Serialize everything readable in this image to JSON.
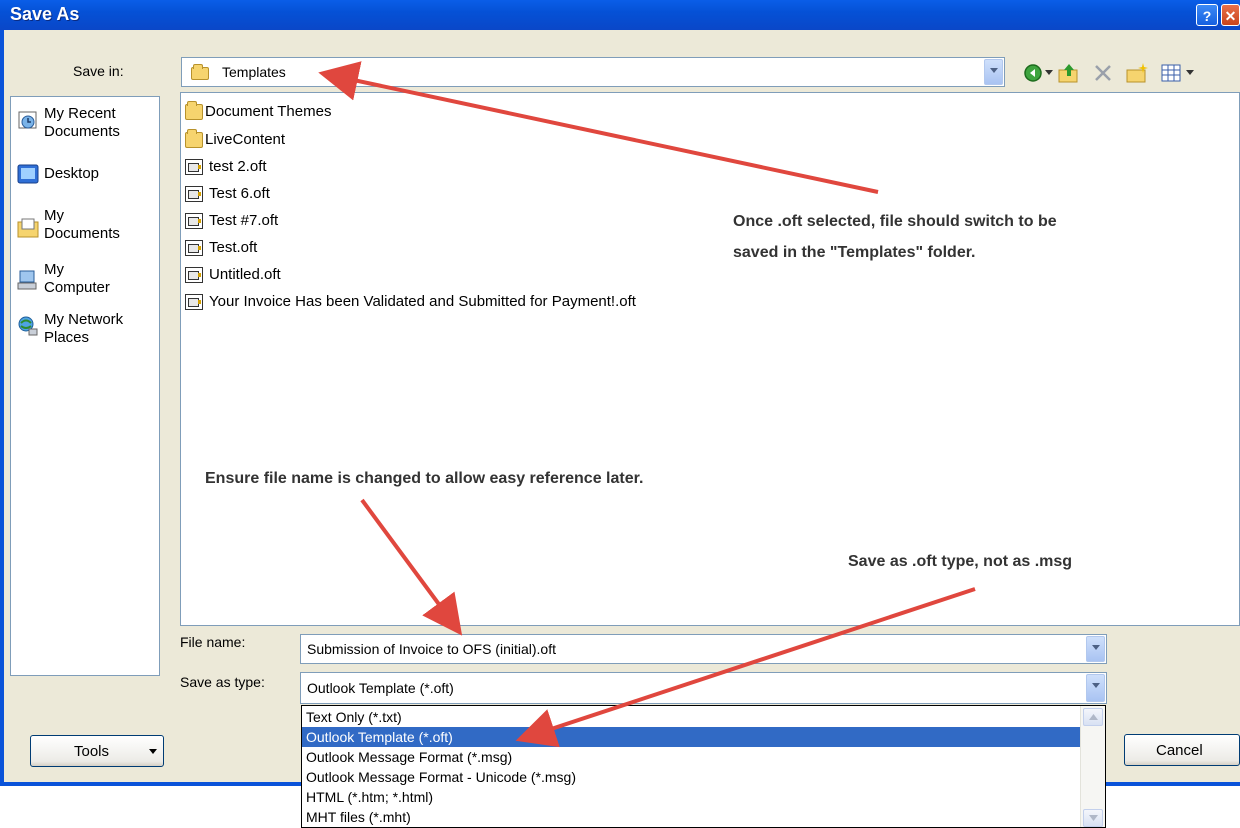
{
  "window": {
    "title": "Save As",
    "help_glyph": "?",
    "close_glyph": "✕"
  },
  "save_in": {
    "label": "Save in:",
    "value": "Templates",
    "icon": "folder-icon"
  },
  "toolbar": {
    "icons": [
      "back-icon",
      "up-folder-icon",
      "delete-icon",
      "new-folder-icon",
      "views-icon"
    ]
  },
  "places": [
    {
      "label": "My Recent Documents",
      "lines": [
        "My Recent",
        "Documents"
      ],
      "icon": "recent-documents-icon"
    },
    {
      "label": "Desktop",
      "lines": [
        "Desktop"
      ],
      "icon": "desktop-icon"
    },
    {
      "label": "My Documents",
      "lines": [
        "My",
        "Documents"
      ],
      "icon": "my-documents-icon"
    },
    {
      "label": "My Computer",
      "lines": [
        "My",
        "Computer"
      ],
      "icon": "my-computer-icon"
    },
    {
      "label": "My Network Places",
      "lines": [
        "My Network",
        "Places"
      ],
      "icon": "network-places-icon"
    }
  ],
  "files": [
    {
      "name": "Document Themes",
      "type": "folder"
    },
    {
      "name": "LiveContent",
      "type": "folder"
    },
    {
      "name": "test 2.oft",
      "type": "oft"
    },
    {
      "name": "Test 6.oft",
      "type": "oft"
    },
    {
      "name": "Test #7.oft",
      "type": "oft"
    },
    {
      "name": "Test.oft",
      "type": "oft"
    },
    {
      "name": "Untitled.oft",
      "type": "oft"
    },
    {
      "name": "Your Invoice Has been Validated and Submitted for Payment!.oft",
      "type": "oft"
    }
  ],
  "file_name": {
    "label": "File name:",
    "value": "Submission of Invoice to OFS (initial).oft"
  },
  "save_as_type": {
    "label": "Save as type:",
    "value": "Outlook Template (*.oft)",
    "options": [
      "Text Only (*.txt)",
      "Outlook Template (*.oft)",
      "Outlook Message Format (*.msg)",
      "Outlook Message Format - Unicode (*.msg)",
      "HTML (*.htm; *.html)",
      "MHT files (*.mht)"
    ],
    "selected_index": 1
  },
  "buttons": {
    "tools": "Tools",
    "cancel": "Cancel"
  },
  "annotations": {
    "templates_note_line1": "Once .oft selected, file should switch to be",
    "templates_note_line2": "saved in the \"Templates\" folder.",
    "filename_note": "Ensure file name is changed to allow easy reference later.",
    "type_note": "Save as .oft type, not as .msg"
  },
  "colors": {
    "title_bar": "#0a53d9",
    "dialog_bg": "#ece9d8",
    "selection": "#316ac5",
    "arrow": "#e0473e"
  }
}
